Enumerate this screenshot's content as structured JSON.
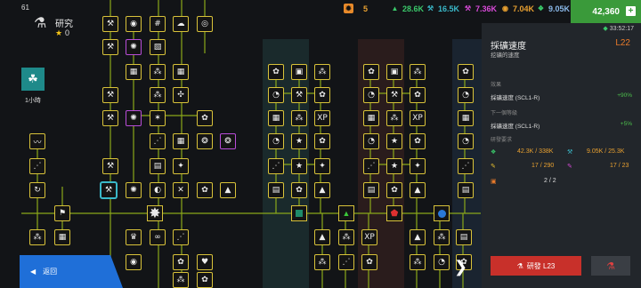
{
  "corner_number": "61",
  "research": {
    "title": "研究",
    "stars": "0"
  },
  "boost": {
    "time": "1小時"
  },
  "topbar": {
    "gems": "5",
    "res1": "28.6K",
    "res2": "16.5K",
    "res3": "7.36K",
    "res4": "7.04K",
    "res5": "9.05K",
    "money": "42,360"
  },
  "panel": {
    "timer": "33:52:17",
    "title": "採礦速度",
    "level": "L22",
    "subtitle": "挖礦的速度",
    "effect_header": "效果",
    "effect_name": "採礦速度 (SCL1-R)",
    "effect_value": "+90%",
    "next_header": "下一個等級",
    "next_name": "採礦速度 (SCL1-R)",
    "next_value": "+5%",
    "req_header": "研發要求",
    "req1": "42.3K / 338K",
    "req2": "9.05K / 25.3K",
    "req3": "17 / 290",
    "req4": "17 / 23",
    "req5": "2 / 2",
    "dev_label": "研發 L23"
  },
  "back_label": "返回",
  "colors": {
    "accent_gold": "#d8c23a",
    "accent_purple": "#b84dd8",
    "button_red": "#c8302a",
    "back_blue": "#1f6fd8",
    "money_green": "#3a9a3a"
  }
}
